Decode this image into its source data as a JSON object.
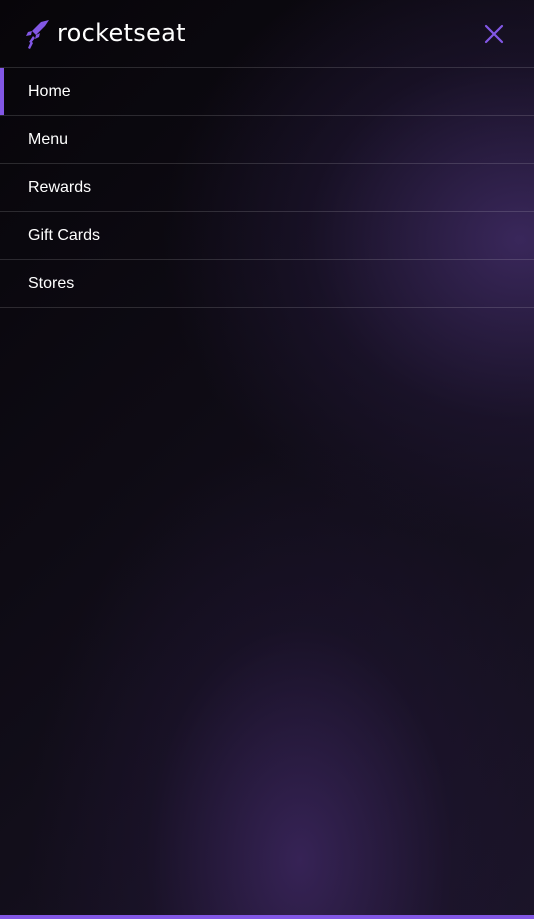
{
  "header": {
    "logo_text": "rocketseat",
    "logo_icon": "rocket-icon",
    "close_icon": "close-icon"
  },
  "nav": {
    "items": [
      {
        "label": "Home",
        "active": true
      },
      {
        "label": "Menu",
        "active": false
      },
      {
        "label": "Rewards",
        "active": false
      },
      {
        "label": "Gift Cards",
        "active": false
      },
      {
        "label": "Stores",
        "active": false
      }
    ]
  },
  "colors": {
    "accent": "#8257e5",
    "text": "#ffffff",
    "background_dark": "#0a080d",
    "background_glow": "#3c265f",
    "divider": "rgba(255,255,255,0.14)"
  }
}
